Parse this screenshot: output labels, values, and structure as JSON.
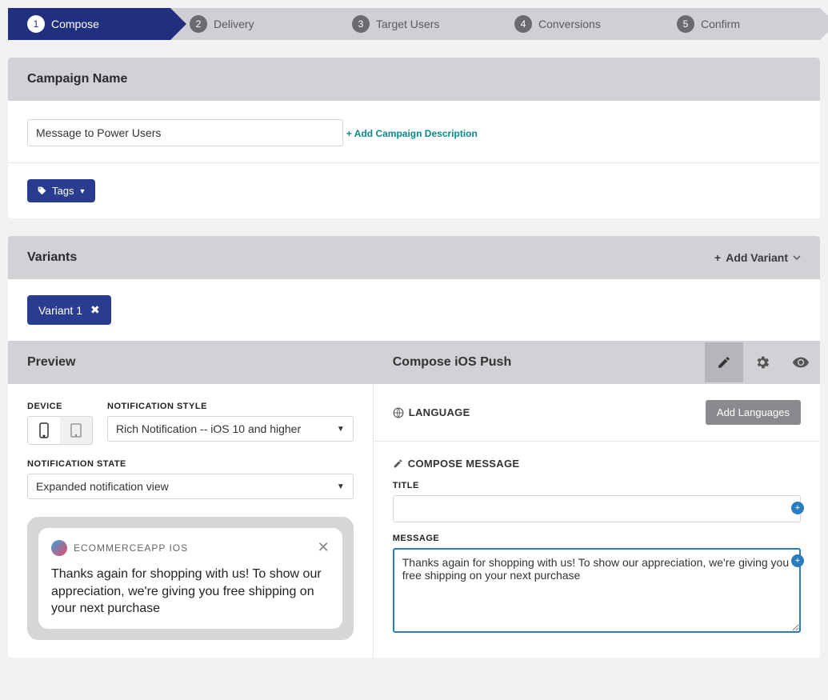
{
  "steps": [
    {
      "num": "1",
      "label": "Compose",
      "active": true
    },
    {
      "num": "2",
      "label": "Delivery",
      "active": false
    },
    {
      "num": "3",
      "label": "Target Users",
      "active": false
    },
    {
      "num": "4",
      "label": "Conversions",
      "active": false
    },
    {
      "num": "5",
      "label": "Confirm",
      "active": false
    }
  ],
  "campaign": {
    "header": "Campaign Name",
    "name_value": "Message to Power Users",
    "add_description": "Add Campaign Description",
    "tags_label": "Tags"
  },
  "variants": {
    "header": "Variants",
    "add_label": "Add Variant",
    "chip": "Variant 1"
  },
  "preview": {
    "header": "Preview",
    "compose_header": "Compose iOS Push",
    "device_label": "DEVICE",
    "style_label": "NOTIFICATION STYLE",
    "style_value": "Rich Notification -- iOS 10 and higher",
    "state_label": "NOTIFICATION STATE",
    "state_value": "Expanded notification view",
    "notif_app": "ECOMMERCEAPP IOS",
    "notif_message": "Thanks again for shopping with us! To show our appreciation, we're giving you free shipping on your next purchase"
  },
  "compose": {
    "language_label": "LANGUAGE",
    "add_languages": "Add Languages",
    "compose_message": "COMPOSE MESSAGE",
    "title_label": "TITLE",
    "title_value": "",
    "message_label": "MESSAGE",
    "message_value": "Thanks again for shopping with us! To show our appreciation, we're giving you free shipping on your next purchase"
  }
}
